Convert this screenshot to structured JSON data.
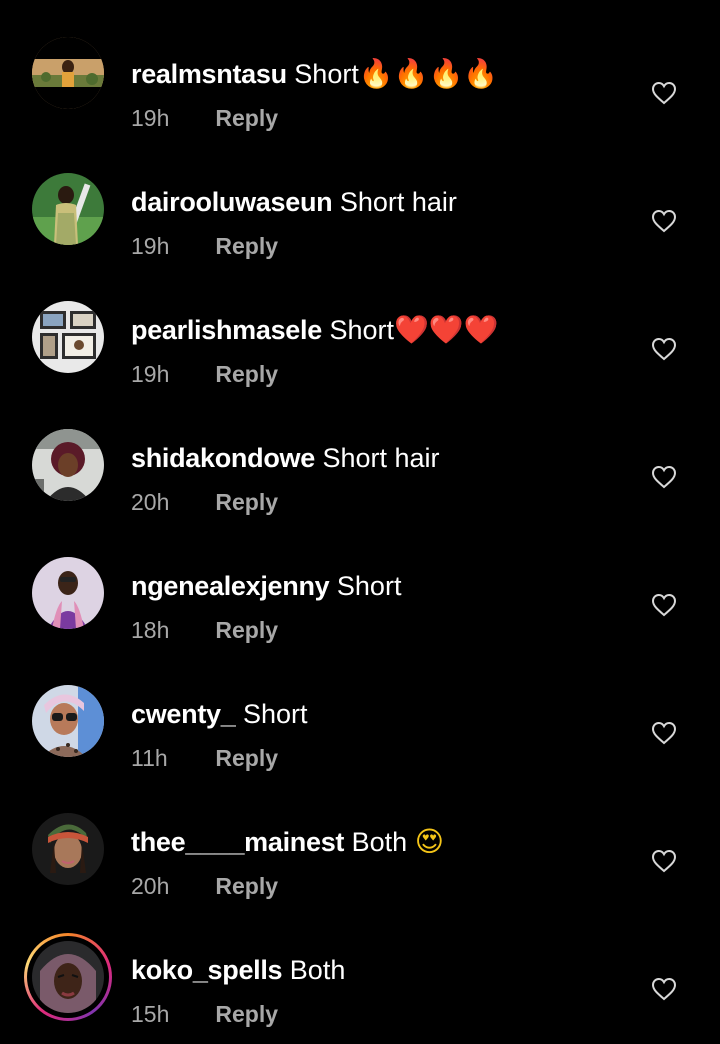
{
  "comments": [
    {
      "username": "realmsntasu",
      "text": "Short",
      "emoji": "🔥🔥🔥🔥",
      "time": "19h",
      "reply": "Reply",
      "avatar": "photo-warm"
    },
    {
      "username": "dairooluwaseun",
      "text": "Short hair",
      "emoji": "",
      "time": "19h",
      "reply": "Reply",
      "avatar": "photo-green"
    },
    {
      "username": "pearlishmasele",
      "text": "Short",
      "emoji": "❤️❤️❤️",
      "time": "19h",
      "reply": "Reply",
      "avatar": "photo-frames"
    },
    {
      "username": "shidakondowe",
      "text": "Short hair",
      "emoji": "",
      "time": "20h",
      "reply": "Reply",
      "avatar": "photo-car"
    },
    {
      "username": "ngenealexjenny",
      "text": "Short",
      "emoji": "",
      "time": "18h",
      "reply": "Reply",
      "avatar": "photo-purple"
    },
    {
      "username": "cwenty_",
      "text": "Short",
      "emoji": "",
      "time": "11h",
      "reply": "Reply",
      "avatar": "photo-glasses"
    },
    {
      "username": "thee____mainest",
      "text": "Both",
      "emoji": "😍",
      "time": "20h",
      "reply": "Reply",
      "avatar": "photo-bandana"
    },
    {
      "username": "koko_spells",
      "text": "Both",
      "emoji": "",
      "time": "15h",
      "reply": "Reply",
      "avatar": "photo-story"
    }
  ],
  "icons": {
    "like": "heart-outline-icon"
  },
  "colors": {
    "background": "#000000",
    "text": "#ffffff",
    "secondary": "#a8a8a8"
  }
}
